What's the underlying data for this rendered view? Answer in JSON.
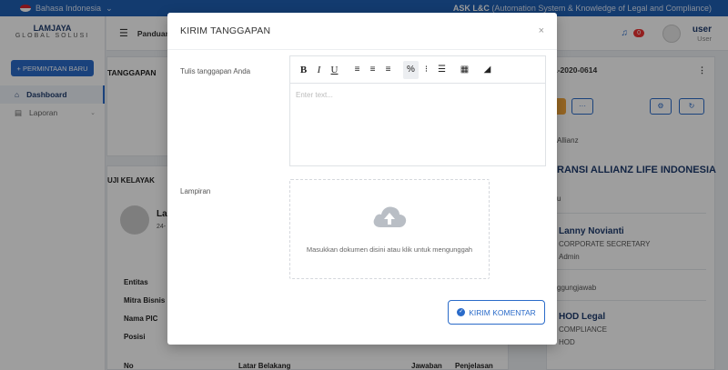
{
  "topbar": {
    "language": "Bahasa Indonesia",
    "app_name_bold": "ASK L&C",
    "app_name_rest": " (Automation System & Knowledge of Legal and Compliance)"
  },
  "sidebar": {
    "logo_line1": "LAMJAYA",
    "logo_line2": "GLOBAL SOLUSI",
    "new_request": "+ PERMINTAAN BARU",
    "items": [
      {
        "label": "Dashboard"
      },
      {
        "label": "Laporan"
      }
    ]
  },
  "header": {
    "panduan": "Panduan",
    "notif_count": "0",
    "user_name": "user",
    "user_role": "User"
  },
  "left": {
    "tanggapan_title": "TANGGAPAN",
    "uji_title": "UJI KELAYAK",
    "name_fragment": "La",
    "date_fragment": "24-",
    "fields": [
      "Entitas",
      "Mitra Bisnis",
      "Nama PIC",
      "Posisi"
    ],
    "table_headers": [
      "No",
      "Latar Belakang",
      "Jawaban",
      "Penjelasan"
    ]
  },
  "right": {
    "ref": "1-2020-0614",
    "kebab": "⋮",
    "dots_btn": "···",
    "company_small": "Allianz",
    "company_heading": "RANSI ALLIANZ LIFE INDONESIA",
    "short_fragment": "u",
    "person1_name": "Lanny Novianti",
    "person1_role": "CORPORATE SECRETARY",
    "person1_status": "Admin",
    "resp_fragment": "ggungjawab",
    "person2_name": "HOD Legal",
    "person2_role": "COMPLIANCE",
    "person2_status": "HOD"
  },
  "modal": {
    "title": "KIRIM TANGGAPAN",
    "close": "×",
    "response_label": "Tulis tanggapan Anda",
    "editor_placeholder": "Enter text...",
    "attachment_label": "Lampiran",
    "dropzone_text": "Masukkan dokumen disini atau klik untuk mengunggah",
    "submit_label": "KIRIM KOMENTAR"
  }
}
